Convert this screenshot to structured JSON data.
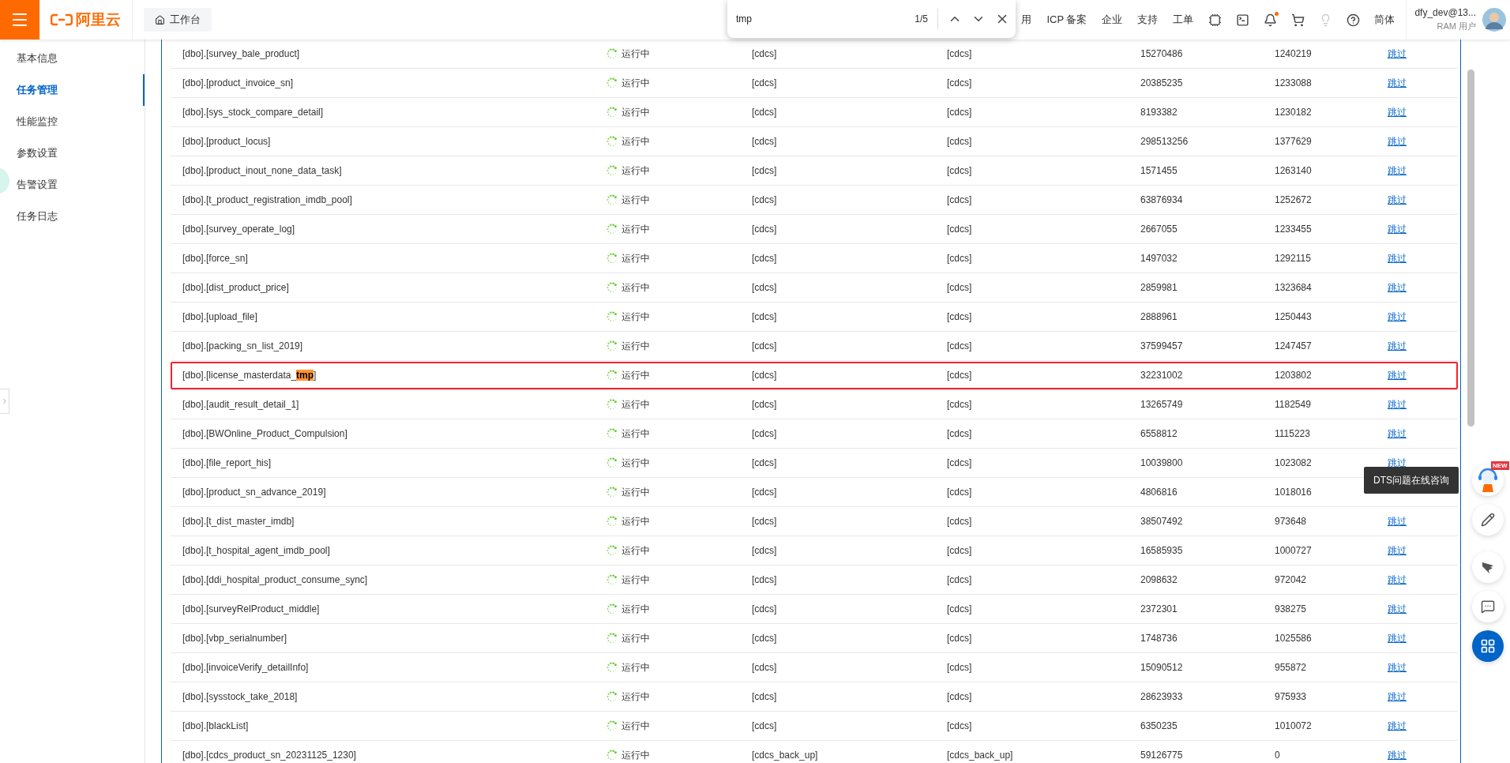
{
  "topbar": {
    "logo": "阿里云",
    "workbench": "工作台",
    "nav": [
      {
        "label": "用"
      },
      {
        "label": "ICP 备案"
      },
      {
        "label": "企业"
      },
      {
        "label": "支持"
      },
      {
        "label": "工单"
      }
    ],
    "icons": [
      {
        "kind": "chip",
        "badge": false,
        "disabled": false
      },
      {
        "kind": "terminal",
        "badge": false,
        "disabled": false
      },
      {
        "kind": "bell",
        "badge": true,
        "disabled": false
      },
      {
        "kind": "cart",
        "badge": false,
        "disabled": false
      },
      {
        "kind": "bulb",
        "badge": false,
        "disabled": true
      },
      {
        "kind": "help",
        "badge": false,
        "disabled": false
      }
    ],
    "language": "简体",
    "user": {
      "name": "dfy_dev@13...",
      "role": "RAM 用户"
    }
  },
  "find_bar": {
    "value": "tmp",
    "count": "1/5"
  },
  "sidebar": {
    "items": [
      {
        "label": "基本信息",
        "selected": false
      },
      {
        "label": "任务管理",
        "selected": true
      },
      {
        "label": "性能监控",
        "selected": false
      },
      {
        "label": "参数设置",
        "selected": false
      },
      {
        "label": "告警设置",
        "selected": false
      },
      {
        "label": "任务日志",
        "selected": false
      }
    ]
  },
  "table": {
    "rows": [
      {
        "name": "[dbo].[survey_bale_product]",
        "status": "运行中",
        "source": "[cdcs]",
        "target": "[cdcs]",
        "column_5": "15270486",
        "column_6": "1240219",
        "action": "跳过",
        "highlighted": false
      },
      {
        "name": "[dbo].[product_invoice_sn]",
        "status": "运行中",
        "source": "[cdcs]",
        "target": "[cdcs]",
        "column_5": "20385235",
        "column_6": "1233088",
        "action": "跳过",
        "highlighted": false
      },
      {
        "name": "[dbo].[sys_stock_compare_detail]",
        "status": "运行中",
        "source": "[cdcs]",
        "target": "[cdcs]",
        "column_5": "8193382",
        "column_6": "1230182",
        "action": "跳过",
        "highlighted": false
      },
      {
        "name": "[dbo].[product_locus]",
        "status": "运行中",
        "source": "[cdcs]",
        "target": "[cdcs]",
        "column_5": "298513256",
        "column_6": "1377629",
        "action": "跳过",
        "highlighted": false
      },
      {
        "name": "[dbo].[product_inout_none_data_task]",
        "status": "运行中",
        "source": "[cdcs]",
        "target": "[cdcs]",
        "column_5": "1571455",
        "column_6": "1263140",
        "action": "跳过",
        "highlighted": false
      },
      {
        "name": "[dbo].[t_product_registration_imdb_pool]",
        "status": "运行中",
        "source": "[cdcs]",
        "target": "[cdcs]",
        "column_5": "63876934",
        "column_6": "1252672",
        "action": "跳过",
        "highlighted": false
      },
      {
        "name": "[dbo].[survey_operate_log]",
        "status": "运行中",
        "source": "[cdcs]",
        "target": "[cdcs]",
        "column_5": "2667055",
        "column_6": "1233455",
        "action": "跳过",
        "highlighted": false
      },
      {
        "name": "[dbo].[force_sn]",
        "status": "运行中",
        "source": "[cdcs]",
        "target": "[cdcs]",
        "column_5": "1497032",
        "column_6": "1292115",
        "action": "跳过",
        "highlighted": false
      },
      {
        "name": "[dbo].[dist_product_price]",
        "status": "运行中",
        "source": "[cdcs]",
        "target": "[cdcs]",
        "column_5": "2859981",
        "column_6": "1323684",
        "action": "跳过",
        "highlighted": false
      },
      {
        "name": "[dbo].[upload_file]",
        "status": "运行中",
        "source": "[cdcs]",
        "target": "[cdcs]",
        "column_5": "2888961",
        "column_6": "1250443",
        "action": "跳过",
        "highlighted": false
      },
      {
        "name": "[dbo].[packing_sn_list_2019]",
        "status": "运行中",
        "source": "[cdcs]",
        "target": "[cdcs]",
        "column_5": "37599457",
        "column_6": "1247457",
        "action": "跳过",
        "highlighted": false
      },
      {
        "name": "[dbo].[license_masterdata_",
        "match": "tmp",
        "name_end": "]",
        "status": "运行中",
        "source": "[cdcs]",
        "target": "[cdcs]",
        "column_5": "32231002",
        "column_6": "1203802",
        "action": "跳过",
        "highlighted": true
      },
      {
        "name": "[dbo].[audit_result_detail_1]",
        "status": "运行中",
        "source": "[cdcs]",
        "target": "[cdcs]",
        "column_5": "13265749",
        "column_6": "1182549",
        "action": "跳过",
        "highlighted": false
      },
      {
        "name": "[dbo].[BWOnline_Product_Compulsion]",
        "status": "运行中",
        "source": "[cdcs]",
        "target": "[cdcs]",
        "column_5": "6558812",
        "column_6": "1115223",
        "action": "跳过",
        "highlighted": false
      },
      {
        "name": "[dbo].[file_report_his]",
        "status": "运行中",
        "source": "[cdcs]",
        "target": "[cdcs]",
        "column_5": "10039800",
        "column_6": "1023082",
        "action": "跳过",
        "highlighted": false
      },
      {
        "name": "[dbo].[product_sn_advance_2019]",
        "status": "运行中",
        "source": "[cdcs]",
        "target": "[cdcs]",
        "column_5": "4806816",
        "column_6": "1018016",
        "highlighted": false
      },
      {
        "name": "[dbo].[t_dist_master_imdb]",
        "status": "运行中",
        "source": "[cdcs]",
        "target": "[cdcs]",
        "column_5": "38507492",
        "column_6": "973648",
        "action": "跳过",
        "highlighted": false
      },
      {
        "name": "[dbo].[t_hospital_agent_imdb_pool]",
        "status": "运行中",
        "source": "[cdcs]",
        "target": "[cdcs]",
        "column_5": "16585935",
        "column_6": "1000727",
        "action": "跳过",
        "highlighted": false
      },
      {
        "name": "[dbo].[ddi_hospital_product_consume_sync]",
        "status": "运行中",
        "source": "[cdcs]",
        "target": "[cdcs]",
        "column_5": "2098632",
        "column_6": "972042",
        "action": "跳过",
        "highlighted": false
      },
      {
        "name": "[dbo].[surveyRelProduct_middle]",
        "status": "运行中",
        "source": "[cdcs]",
        "target": "[cdcs]",
        "column_5": "2372301",
        "column_6": "938275",
        "action": "跳过",
        "highlighted": false
      },
      {
        "name": "[dbo].[vbp_serialnumber]",
        "status": "运行中",
        "source": "[cdcs]",
        "target": "[cdcs]",
        "column_5": "1748736",
        "column_6": "1025586",
        "action": "跳过",
        "highlighted": false
      },
      {
        "name": "[dbo].[invoiceVerify_detailInfo]",
        "status": "运行中",
        "source": "[cdcs]",
        "target": "[cdcs]",
        "column_5": "15090512",
        "column_6": "955872",
        "action": "跳过",
        "highlighted": false
      },
      {
        "name": "[dbo].[sysstock_take_2018]",
        "status": "运行中",
        "source": "[cdcs]",
        "target": "[cdcs]",
        "column_5": "28623933",
        "column_6": "975933",
        "action": "跳过",
        "highlighted": false
      },
      {
        "name": "[dbo].[blackList]",
        "status": "运行中",
        "source": "[cdcs]",
        "target": "[cdcs]",
        "column_5": "6350235",
        "column_6": "1010072",
        "action": "跳过",
        "highlighted": false
      },
      {
        "name": "[dbo].[cdcs_product_sn_20231125_1230]",
        "status": "运行中",
        "source": "[cdcs_back_up]",
        "target": "[cdcs_back_up]",
        "column_5": "59126775",
        "column_6": "0",
        "action": "跳过",
        "highlighted": false
      }
    ]
  },
  "assistant": {
    "tooltip": "DTS问题在线咨询",
    "badge": "NEW"
  },
  "float_buttons": [
    {
      "kind": "pencil"
    },
    {
      "kind": "wing"
    },
    {
      "kind": "chat"
    },
    {
      "kind": "apps"
    }
  ]
}
